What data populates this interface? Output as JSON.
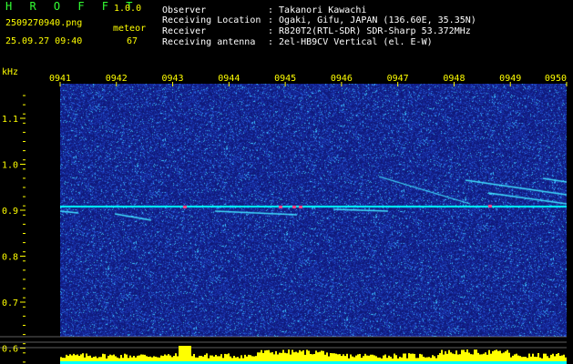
{
  "header": {
    "app_name": "H R O F F T",
    "version": "1.0.0",
    "filename": "2509270940.png",
    "timestamp": "25.09.27 09:40",
    "meteor_label": "meteor",
    "meteor_count": "67"
  },
  "info": {
    "observer_label": "Observer",
    "observer_value": ": Takanori Kawachi",
    "location_label": "Receiving Location",
    "location_value": ": Ogaki, Gifu, JAPAN (136.60E, 35.35N)",
    "receiver_label": "Receiver",
    "receiver_value": ": R820T2(RTL-SDR) SDR-Sharp 53.372MHz",
    "antenna_label": "Receiving antenna",
    "antenna_value": ": 2el-HB9CV Vertical (el. E-W)"
  },
  "axis": {
    "y_unit": "kHz",
    "y_ticks": [
      "1.1",
      "1.0",
      "0.9",
      "0.8",
      "0.7",
      "0.6"
    ],
    "x_ticks": [
      "0941",
      "0942",
      "0943",
      "0944",
      "0945",
      "0946",
      "0947",
      "0948",
      "0949",
      "0950"
    ]
  },
  "colors": {
    "background": "#000000",
    "spectrogram_bg": "#1a2a8c",
    "carrier": "#00ffff",
    "level_bars": "#ffff00",
    "title_green": "#33ff33",
    "text_yellow": "#ffff00"
  }
}
